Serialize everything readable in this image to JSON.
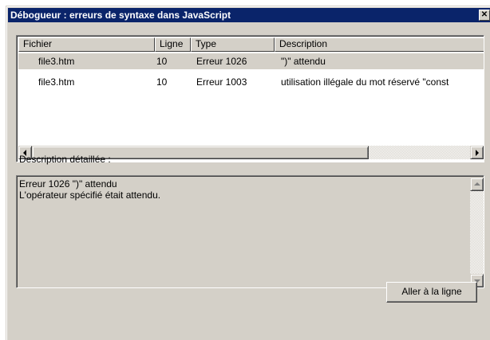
{
  "window": {
    "title": "Débogueur : erreurs de syntaxe dans JavaScript",
    "close_glyph": "✕"
  },
  "table": {
    "columns": [
      "Fichier",
      "Ligne",
      "Type",
      "Description"
    ],
    "rows": [
      {
        "file": "file3.htm",
        "line": "10",
        "type": "Erreur 1026",
        "description": "\")\" attendu",
        "selected": true
      },
      {
        "file": "file3.htm",
        "line": "10",
        "type": "Erreur 1003",
        "description": "utilisation illégale du mot réservé \"const",
        "selected": false
      }
    ]
  },
  "detail": {
    "label": "Description détaillée :",
    "text": "Erreur 1026 \")\" attendu\nL'opérateur spécifié était attendu."
  },
  "buttons": {
    "goto_label": "Aller à la ligne"
  },
  "icons": {
    "scroll_left": "arrow-left-icon",
    "scroll_right": "arrow-right-icon",
    "scroll_up": "arrow-up-icon",
    "scroll_down": "arrow-down-icon"
  },
  "colors": {
    "titlebar": "#0a246a",
    "face": "#d4d0c8",
    "selected_row": "#d4d0c8"
  }
}
